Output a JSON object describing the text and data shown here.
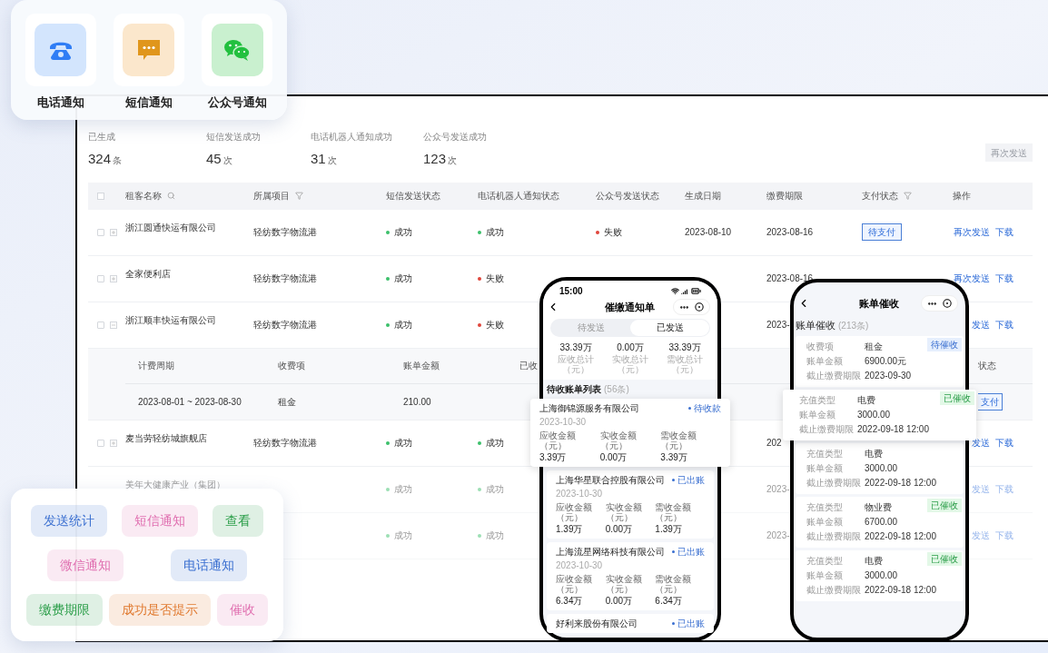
{
  "channel_card": {
    "channels": [
      {
        "kind": "phone",
        "label": "电话通知"
      },
      {
        "kind": "sms",
        "label": "短信通知"
      },
      {
        "kind": "wechat",
        "label": "公众号通知"
      }
    ]
  },
  "panel": {
    "stats": [
      {
        "label": "已生成",
        "value": "324",
        "unit": "条"
      },
      {
        "label": "短信发送成功",
        "value": "45",
        "unit": "次"
      },
      {
        "label": "电话机器人通知成功",
        "value": "31",
        "unit": "次"
      },
      {
        "label": "公众号发送成功",
        "value": "123",
        "unit": "次"
      }
    ],
    "resend_button": {
      "label": "再次发送",
      "disabled": true
    },
    "table": {
      "columns": [
        {
          "label": "租客名称",
          "kind": "searchable"
        },
        {
          "label": "所属项目",
          "kind": "filterable"
        },
        {
          "label": "短信发送状态"
        },
        {
          "label": "电话机器人通知状态"
        },
        {
          "label": "公众号发送状态"
        },
        {
          "label": "生成日期"
        },
        {
          "label": "缴费期限"
        },
        {
          "label": "支付状态",
          "kind": "filterable"
        },
        {
          "label": "操作"
        }
      ],
      "all_checked": false,
      "rows": [
        {
          "checked": false,
          "expanded": false,
          "dimmed": false,
          "tenant": "浙江圆通快运有限公司",
          "project": "轻纺数字物流港",
          "sms": {
            "text": "成功",
            "kind": "success"
          },
          "robot": {
            "text": "成功",
            "kind": "success"
          },
          "wechat": {
            "text": "失败",
            "kind": "fail"
          },
          "created": "2023-08-10",
          "deadline": "2023-08-16",
          "payment": "待支付",
          "actions": [
            "再次发送",
            "下载"
          ]
        },
        {
          "checked": false,
          "expanded": false,
          "dimmed": false,
          "tenant": "全家便利店",
          "project": "轻纺数字物流港",
          "sms": {
            "text": "成功",
            "kind": "success"
          },
          "robot": {
            "text": "失败",
            "kind": "fail"
          },
          "deadline": "2023-08-16",
          "actions": [
            "再次发送",
            "下载"
          ]
        },
        {
          "checked": false,
          "expanded": true,
          "dimmed": false,
          "tenant": "浙江顺丰快运有限公司",
          "project": "轻纺数字物流港",
          "sms": {
            "text": "成功",
            "kind": "success"
          },
          "robot": {
            "text": "失败",
            "kind": "fail"
          },
          "deadline": "2023-",
          "actions": [
            "发送",
            "下载"
          ],
          "detail": {
            "columns": [
              "计费周期",
              "收费项",
              "账单金额",
              "已收"
            ],
            "end_column": "状态",
            "rows": [
              {
                "cells": [
                  "2023-08-01 ~ 2023-08-30",
                  "租金",
                  "210.00"
                ],
                "payment": "支付"
              }
            ]
          }
        },
        {
          "checked": false,
          "dimmed": false,
          "expanded": false,
          "tenant": "麦当劳轻纺城旗舰店",
          "project": "轻纺数字物流港",
          "sms": {
            "text": "成功",
            "kind": "success"
          },
          "robot": {
            "text": "成功",
            "kind": "success"
          },
          "deadline": "202",
          "actions": [
            "发送",
            "下载"
          ]
        },
        {
          "dimmed": true,
          "tenant": "美年大健康产业（集团）",
          "sms": {
            "text": "成功",
            "kind": "success"
          },
          "robot": {
            "text": "成功",
            "kind": "success"
          },
          "deadline": "2023-",
          "actions": [
            "发送",
            "下载"
          ]
        },
        {
          "dimmed": true,
          "sms": {
            "text": "成功",
            "kind": "success"
          },
          "robot": {
            "text": "成功",
            "kind": "success"
          },
          "deadline": "2023-",
          "actions": [
            "发送",
            "下载"
          ]
        }
      ]
    }
  },
  "phone_notice": {
    "time": "15:00",
    "title": "催缴通知单",
    "tabs": [
      {
        "label": "待发送",
        "selected": false
      },
      {
        "label": "已发送",
        "selected": true
      }
    ],
    "totals": [
      {
        "value": "33.39万",
        "label": "应收总计（元）"
      },
      {
        "value": "0.00万",
        "label": "实收总计（元）"
      },
      {
        "value": "33.39万",
        "label": "需收总计（元）"
      }
    ],
    "list_title": "待收账单列表",
    "list_count": "(56条)",
    "bills": [
      {
        "raised": true,
        "company": "上海御锦源服务有限公司",
        "status": "待收款",
        "date": "2023-10-30",
        "amounts": [
          {
            "label": "应收金额（元）",
            "value": "3.39万"
          },
          {
            "label": "实收金额（元）",
            "value": "0.00万"
          },
          {
            "label": "需收金额（元）",
            "value": "3.39万"
          }
        ]
      },
      {
        "raised": false,
        "company": "上海华星联合控股有限公司",
        "status": "已出账",
        "date": "2023-10-30",
        "amounts": [
          {
            "label": "应收金额（元）",
            "value": "1.39万"
          },
          {
            "label": "实收金额（元）",
            "value": "0.00万"
          },
          {
            "label": "需收金额（元）",
            "value": "1.39万"
          }
        ]
      },
      {
        "raised": false,
        "company": "上海流星网络科技有限公司",
        "status": "已出账",
        "date": "2023-10-30",
        "amounts": [
          {
            "label": "应收金额（元）",
            "value": "6.34万"
          },
          {
            "label": "实收金额（元）",
            "value": "0.00万"
          },
          {
            "label": "需收金额（元）",
            "value": "6.34万"
          }
        ]
      },
      {
        "raised": false,
        "company": "好利来股份有限公司",
        "status": "已出账"
      }
    ]
  },
  "phone_collect": {
    "title": "账单催收",
    "list_title": "账单催收",
    "list_count": "(213条)",
    "bills": [
      {
        "raised": false,
        "tag": {
          "text": "待催收",
          "kind": "pending"
        },
        "fields": [
          {
            "label": "收费项",
            "value": "租金"
          },
          {
            "label": "账单金额",
            "value": "6900.00元"
          },
          {
            "label": "截止缴费期限",
            "value": "2023-09-30"
          }
        ]
      },
      {
        "raised": true,
        "tag": {
          "text": "已催收",
          "kind": "done"
        },
        "fields": [
          {
            "label": "充值类型",
            "value": "电费"
          },
          {
            "label": "账单金额",
            "value": "3000.00"
          },
          {
            "label": "截止缴费期限",
            "value": "2022-09-18 12:00"
          }
        ]
      },
      {
        "raised": false,
        "fields": [
          {
            "label": "充值类型",
            "value": "电费"
          },
          {
            "label": "账单金额",
            "value": "3000.00"
          },
          {
            "label": "截止缴费期限",
            "value": "2022-09-18 12:00"
          }
        ]
      },
      {
        "raised": false,
        "tag": {
          "text": "已催收",
          "kind": "done"
        },
        "fields": [
          {
            "label": "充值类型",
            "value": "物业费"
          },
          {
            "label": "账单金额",
            "value": "6700.00"
          },
          {
            "label": "截止缴费期限",
            "value": "2022-09-18 12:00"
          }
        ]
      },
      {
        "raised": false,
        "tag": {
          "text": "已催收",
          "kind": "done"
        },
        "fields": [
          {
            "label": "充值类型",
            "value": "电费"
          },
          {
            "label": "账单金额",
            "value": "3000.00"
          },
          {
            "label": "截止缴费期限",
            "value": "2022-09-18 12:00"
          }
        ]
      }
    ]
  },
  "tag_card": {
    "rows": [
      [
        {
          "text": "发送统计",
          "color": "#3a6fd0"
        },
        {
          "text": "短信通知",
          "color": "#e06fb0"
        },
        {
          "text": "查看",
          "color": "#2a9d48"
        }
      ],
      [
        {
          "text": "微信通知",
          "color": "#e06fb0"
        },
        {
          "text": "电话通知",
          "color": "#3a6fd0"
        }
      ],
      [
        {
          "text": "缴费期限",
          "color": "#2a9d48"
        },
        {
          "text": "成功是否提示",
          "color": "#e07a30"
        },
        {
          "text": "催收",
          "color": "#e06fb0"
        }
      ]
    ]
  }
}
